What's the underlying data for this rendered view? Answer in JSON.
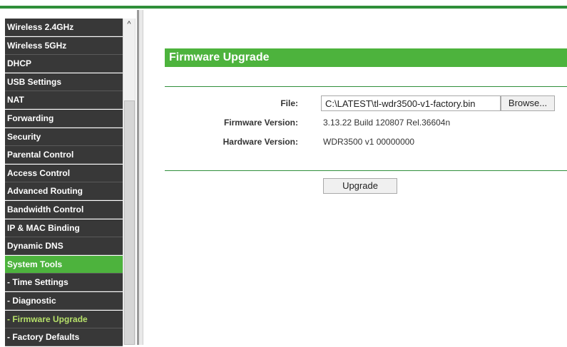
{
  "sidebar": {
    "items": [
      {
        "label": "Wireless 2.4GHz"
      },
      {
        "label": "Wireless 5GHz"
      },
      {
        "label": "DHCP"
      },
      {
        "label": "USB Settings"
      },
      {
        "label": "NAT"
      },
      {
        "label": "Forwarding"
      },
      {
        "label": "Security"
      },
      {
        "label": "Parental Control"
      },
      {
        "label": "Access Control"
      },
      {
        "label": "Advanced Routing"
      },
      {
        "label": "Bandwidth Control"
      },
      {
        "label": "IP & MAC Binding"
      },
      {
        "label": "Dynamic DNS"
      },
      {
        "label": "System Tools"
      },
      {
        "label": "- Time Settings"
      },
      {
        "label": "- Diagnostic"
      },
      {
        "label": "- Firmware Upgrade"
      },
      {
        "label": "- Factory Defaults"
      }
    ],
    "scroll_up_icon": "chevron-up-icon"
  },
  "main": {
    "title": "Firmware Upgrade",
    "file_label": "File:",
    "file_value": "C:\\LATEST\\tl-wdr3500-v1-factory.bin",
    "browse_label": "Browse...",
    "firmware_label": "Firmware Version:",
    "firmware_value": "3.13.22 Build 120807 Rel.36604n",
    "hardware_label": "Hardware Version:",
    "hardware_value": "WDR3500 v1 00000000",
    "upgrade_label": "Upgrade"
  },
  "colors": {
    "menu_bg": "#383838",
    "accent_green": "#4db33d",
    "current_sub": "#b6e06a",
    "rule_green": "#2f8f3a"
  }
}
